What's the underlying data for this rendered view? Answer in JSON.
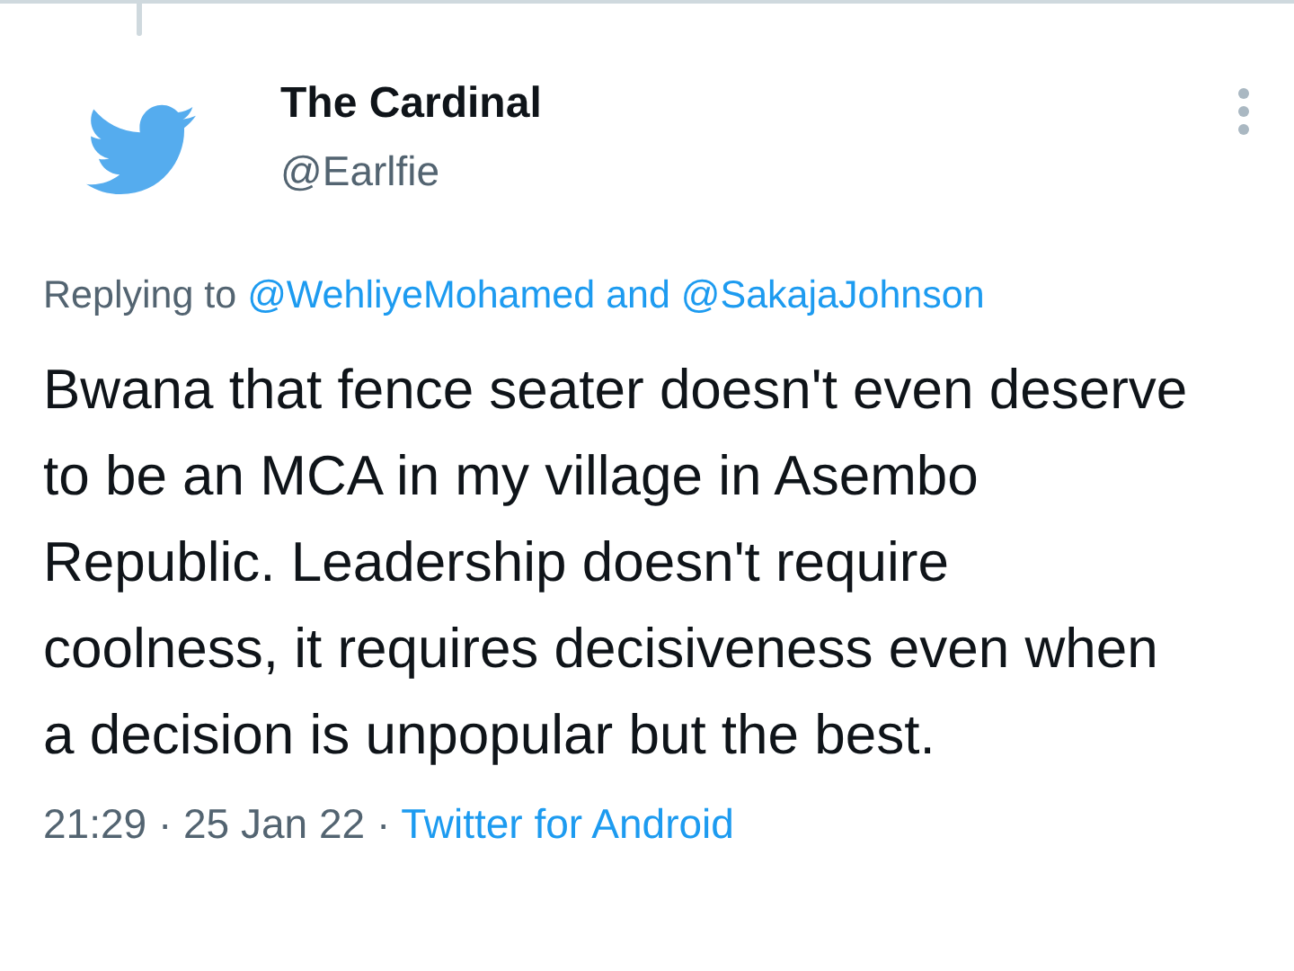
{
  "tweet": {
    "author": {
      "name": "The Cardinal",
      "handle": "@Earlfie"
    },
    "replying": {
      "prefix": "Replying to",
      "mentions": [
        "@WehliyeMohamed",
        "@SakajaJohnson"
      ],
      "joiner": "and"
    },
    "text": "Bwana that fence seater doesn't even deserve to be an MCA in my village in Asembo Republic. Leadership doesn't require coolness, it requires decisiveness even when a decision is unpopular but the best.",
    "footer": {
      "time": "21:29",
      "separator": "·",
      "date": "25 Jan 22",
      "source": "Twitter for Android"
    }
  }
}
